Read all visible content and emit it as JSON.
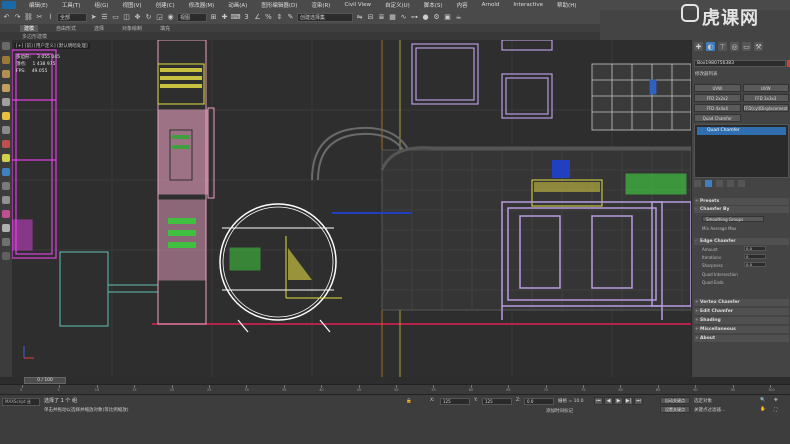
{
  "menu": {
    "items": [
      "编辑(E)",
      "工具(T)",
      "组(G)",
      "视图(V)",
      "创建(C)",
      "修改器(M)",
      "动画(A)",
      "图形编辑器(D)",
      "渲染(R)",
      "Civil View",
      "自定义(U)",
      "脚本(S)",
      "内容",
      "Arnold",
      "Interactive",
      "帮助(H)"
    ]
  },
  "toolbar": {
    "filter_label": "全部",
    "view_label": "视图",
    "selection_set_label": "创建选择集",
    "snap_label": "3",
    "icons": [
      "undo-icon",
      "redo-icon",
      "link-icon",
      "unlink-icon",
      "bind-icon",
      "select-icon",
      "select-region-icon",
      "window-crossing-icon",
      "move-icon",
      "rotate-icon",
      "scale-icon",
      "snap-toggle-icon",
      "angle-snap-icon",
      "percent-snap-icon",
      "spinner-snap-icon",
      "mirror-icon",
      "align-icon",
      "layers-icon",
      "curve-editor-icon",
      "schematic-icon",
      "material-editor-icon",
      "render-setup-icon",
      "render-frame-icon",
      "render-icon"
    ]
  },
  "ribbon": {
    "tabs": [
      "建模",
      "自由形式",
      "选择",
      "对象绘制",
      "填充"
    ],
    "active_tab": "建模",
    "sub_label": "多边形建模"
  },
  "viewport": {
    "label": "[+] [前] [用户定义] [默认明暗处理]",
    "stats": [
      {
        "label": "多边形:",
        "value": "3 055 045"
      },
      {
        "label": "顶点:",
        "value": "1 438 975"
      },
      {
        "label": "FPS:",
        "value": "49.055"
      }
    ]
  },
  "command_panel": {
    "object_name": "Box1980756383",
    "modifier_list_label": "修改器列表",
    "quick_buttons": [
      "UVW",
      "UVW",
      "FFD 2x2x2",
      "FFD 3x3x3",
      "FFD 4x4x4",
      "FFD(cyl)Displacement",
      "Quad Chamfer"
    ],
    "stack_items": [
      "Quad Chamfer"
    ],
    "rollouts": {
      "presets": "Presets",
      "chamfer_by": "Chamfer By",
      "chamfer_by_value": "Smoothing Groups",
      "chamfer_by_option": "Min   Average   Max",
      "edge_chamfer": "Edge Chamfer",
      "amount_label": "Amount",
      "amount_value": "0.0",
      "iterations_label": "Iterations",
      "iterations_value": "0",
      "sharpness_label": "Sharpness",
      "sharpness_value": "0.0",
      "quad_intersection": "Quad Intersection",
      "quad_ends": "Quad Ends",
      "vertex_chamfer": "Vertex Chamfer",
      "edit_chamfer": "Edit Chamfer",
      "shading": "Shading",
      "miscellaneous": "Miscellaneous",
      "about": "About"
    }
  },
  "timeline": {
    "frame_display": "0 / 100",
    "ticks": [
      "0",
      "5",
      "10",
      "15",
      "20",
      "25",
      "30",
      "35",
      "40",
      "45",
      "50",
      "55",
      "60",
      "65",
      "70",
      "75",
      "80",
      "85",
      "90",
      "95",
      "100"
    ]
  },
  "status": {
    "script_box": "MAXScript 迷",
    "selection_text": "选择了 1 个 组",
    "prompt_text": "单击并拖动以选择并缩放对象(等比例缩放)",
    "x_value": "125",
    "y_value": "125",
    "z_value": "0.0",
    "grid_label": "栅格 = 10.0",
    "add_time_tag": "添加时间标记",
    "auto_key": "自动关键点",
    "set_key": "设置关键点",
    "selected_label": "选定对象",
    "key_filters": "关键点过滤器..."
  },
  "watermark": {
    "text": "虎课网"
  },
  "colors": {
    "viewport_bg": "#2e2e2e",
    "selection_white": "#ffffff",
    "magenta": "#e040e0",
    "lavender": "#b89be0",
    "yellow": "#e0e040",
    "green": "#40c040",
    "pink": "#e8a0c0",
    "red_ground": "#e02050",
    "blue_accent": "#2f6fb0"
  }
}
